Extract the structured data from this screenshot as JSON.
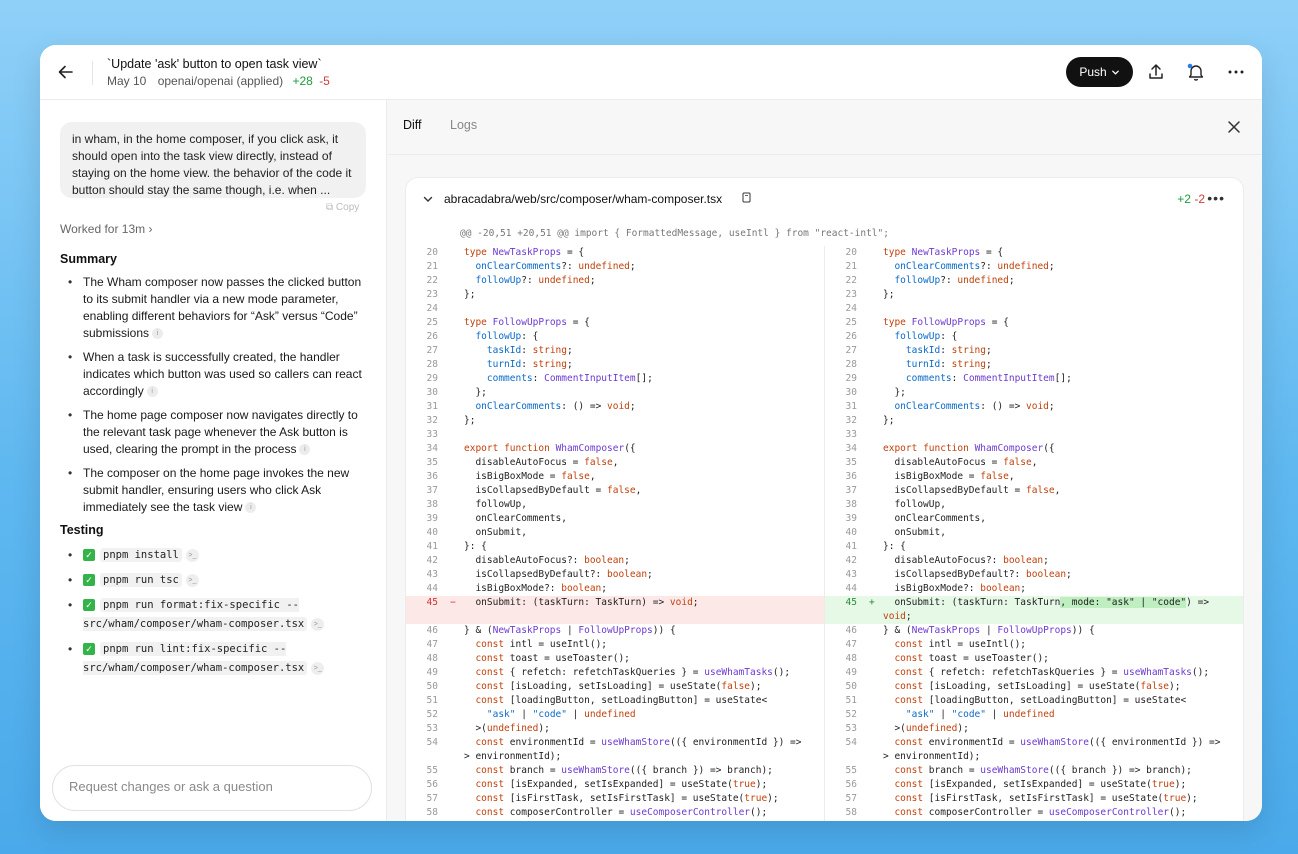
{
  "header": {
    "title": "`Update 'ask' button to open task view`",
    "date": "May 10",
    "repo": "openai/openai (applied)",
    "additions": "+28",
    "deletions": "-5",
    "push_label": "Push"
  },
  "sidebar": {
    "prompt": "in wham, in the home composer, if you click ask, it should open into the task view directly, instead of staying on the home view. the behavior of the code it button should stay the same though, i.e. when ...",
    "copy_label": "Copy",
    "worked_for": "Worked for 13m",
    "summary_title": "Summary",
    "summary_items": [
      "The Wham composer now passes the clicked button to its submit handler via a new mode parameter, enabling different behaviors for “Ask” versus “Code” submissions",
      "When a task is successfully created, the handler indicates which button was used so callers can react accordingly",
      "The home page composer now navigates directly to the relevant task page whenever the Ask button is used, clearing the prompt in the process",
      "The composer on the home page invokes the new submit handler, ensuring users who click Ask immediately see the task view"
    ],
    "testing_title": "Testing",
    "testing_items": [
      "pnpm install",
      "pnpm run tsc",
      "pnpm run format:fix-specific -- src/wham/composer/wham-composer.tsx",
      "pnpm run lint:fix-specific -- src/wham/composer/wham-composer.tsx"
    ],
    "input_placeholder": "Request changes or ask a question"
  },
  "main": {
    "tabs": [
      "Diff",
      "Logs"
    ],
    "file": {
      "name": "abracadabra/web/src/composer/wham-composer.tsx",
      "additions": "+2",
      "deletions": "-2",
      "hunk": "@@ -20,51 +20,51 @@ import { FormattedMessage, useIntl } from \"react-intl\";"
    }
  },
  "diff": {
    "changed_line": 45,
    "left_changed_text": "  onSubmit: (taskTurn: TaskTurn) => void;",
    "right_changed_text": "  onSubmit: (taskTurn: TaskTurn, mode: \"ask\" | \"code\") => void;",
    "right_highlight": ", mode: \"ask\" | \"code\"",
    "lines": [
      {
        "n": 20,
        "t": "type NewTaskProps = {"
      },
      {
        "n": 21,
        "t": "  onClearComments?: undefined;"
      },
      {
        "n": 22,
        "t": "  followUp?: undefined;"
      },
      {
        "n": 23,
        "t": "};"
      },
      {
        "n": 24,
        "t": ""
      },
      {
        "n": 25,
        "t": "type FollowUpProps = {"
      },
      {
        "n": 26,
        "t": "  followUp: {"
      },
      {
        "n": 27,
        "t": "    taskId: string;"
      },
      {
        "n": 28,
        "t": "    turnId: string;"
      },
      {
        "n": 29,
        "t": "    comments: CommentInputItem[];"
      },
      {
        "n": 30,
        "t": "  };"
      },
      {
        "n": 31,
        "t": "  onClearComments: () => void;"
      },
      {
        "n": 32,
        "t": "};"
      },
      {
        "n": 33,
        "t": ""
      },
      {
        "n": 34,
        "t": "export function WhamComposer({"
      },
      {
        "n": 35,
        "t": "  disableAutoFocus = false,"
      },
      {
        "n": 36,
        "t": "  isBigBoxMode = false,"
      },
      {
        "n": 37,
        "t": "  isCollapsedByDefault = false,"
      },
      {
        "n": 38,
        "t": "  followUp,"
      },
      {
        "n": 39,
        "t": "  onClearComments,"
      },
      {
        "n": 40,
        "t": "  onSubmit,"
      },
      {
        "n": 41,
        "t": "}: {"
      },
      {
        "n": 42,
        "t": "  disableAutoFocus?: boolean;"
      },
      {
        "n": 43,
        "t": "  isCollapsedByDefault?: boolean;"
      },
      {
        "n": 44,
        "t": "  isBigBoxMode?: boolean;"
      },
      {
        "n": 45,
        "t": "CHANGED"
      },
      {
        "n": 46,
        "t": "} & (NewTaskProps | FollowUpProps)) {"
      },
      {
        "n": 47,
        "t": "  const intl = useIntl();"
      },
      {
        "n": 48,
        "t": "  const toast = useToaster();"
      },
      {
        "n": 49,
        "t": "  const { refetch: refetchTaskQueries } = useWhamTasks();"
      },
      {
        "n": 50,
        "t": "  const [isLoading, setIsLoading] = useState(false);"
      },
      {
        "n": 51,
        "t": "  const [loadingButton, setLoadingButton] = useState<"
      },
      {
        "n": 52,
        "t": "    \"ask\" | \"code\" | undefined"
      },
      {
        "n": 53,
        "t": "  >(undefined);"
      },
      {
        "n": 54,
        "t": "  const environmentId = useWhamStore(({ environmentId }) =>\n> environmentId);",
        "wrap": true
      },
      {
        "n": 55,
        "t": "  const branch = useWhamStore(({ branch }) => branch);"
      },
      {
        "n": 56,
        "t": "  const [isExpanded, setIsExpanded] = useState(true);"
      },
      {
        "n": 57,
        "t": "  const [isFirstTask, setIsFirstTask] = useState(true);"
      },
      {
        "n": 58,
        "t": "  const composerController = useComposerController();"
      }
    ]
  }
}
